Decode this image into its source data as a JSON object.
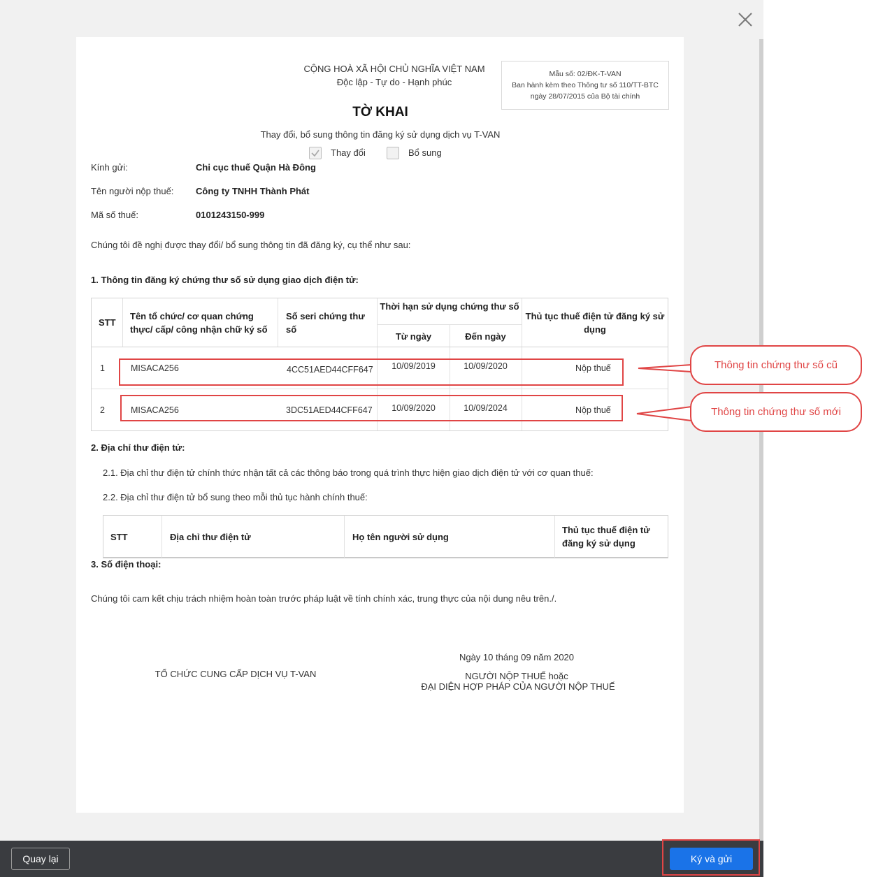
{
  "header": {
    "country": "CỘNG HOÀ XÃ HỘI CHỦ NGHĨA VIỆT NAM",
    "motto": "Độc lập - Tự do - Hạnh phúc",
    "form_no": "Mẫu số: 02/ĐK-T-VAN",
    "form_issued": "Ban hành kèm theo Thông tư số 110/TT-BTC",
    "form_date": "ngày 28/07/2015 của Bộ tài chính"
  },
  "doc": {
    "title": "TỜ KHAI",
    "subtitle": "Thay đổi, bổ sung thông tin đăng ký sử dụng dịch vụ T-VAN",
    "option_change": "Thay đổi",
    "option_add": "Bổ sung",
    "option_change_checked": true,
    "option_add_checked": false
  },
  "fields": [
    {
      "label": "Kính gửi:",
      "value": "Chi cục thuế Quận Hà Đông"
    },
    {
      "label": "Tên người nộp thuế:",
      "value": "Công ty TNHH Thành Phát"
    },
    {
      "label": "Mã số thuế:",
      "value": "0101243150-999"
    }
  ],
  "intro": "Chúng tôi đề nghị được thay đổi/ bổ sung thông tin đã đăng ký, cụ thể như sau:",
  "section1": {
    "title": "1. Thông tin đăng ký chứng thư số sử dụng giao dịch điện tử:",
    "headers": {
      "stt": "STT",
      "org": "Tên tổ chức/ cơ quan chứng thực/ cấp/ công nhận chữ ký số",
      "serial": "Số seri chứng thư số",
      "period": "Thời hạn sử dụng chứng thư số",
      "from": "Từ ngày",
      "to": "Đến ngày",
      "procedure": "Thủ tục thuế điện tử đăng ký sử dụng"
    },
    "rows": [
      {
        "stt": "1",
        "org": "MISACA256",
        "serial": "4CC51AED44CFF647",
        "from": "10/09/2019",
        "to": "10/09/2020",
        "procedure": "Nộp thuế"
      },
      {
        "stt": "2",
        "org": "MISACA256",
        "serial": "3DC51AED44CFF647",
        "from": "10/09/2020",
        "to": "10/09/2024",
        "procedure": "Nộp thuế"
      }
    ]
  },
  "section2": {
    "title": "2. Địa chỉ thư điện tử:",
    "item1": "2.1. Địa chỉ thư điện tử chính thức nhận tất cả các thông báo trong quá trình thực hiện giao dịch điện tử với cơ quan thuế:",
    "item2": "2.2. Địa chỉ thư điện tử bổ sung theo mỗi thủ tục hành chính thuế:",
    "headers": {
      "stt": "STT",
      "email": "Địa chỉ thư điện tử",
      "user": "Họ tên người sử dụng",
      "procedure": "Thủ tục thuế điện tử đăng ký sử dụng"
    }
  },
  "section3": {
    "title": "3. Số điện thoại:"
  },
  "commitment": "Chúng tôi cam kết chịu trách nhiệm hoàn toàn trước pháp luật về tính chính xác, trung thực của nội dung nêu trên./.",
  "signature": {
    "left": "TỔ CHỨC CUNG CẤP DỊCH VỤ T-VAN",
    "date": "Ngày 10 tháng 09 năm 2020",
    "right_line1": "NGƯỜI NỘP THUẾ hoặc",
    "right_line2": "ĐẠI DIỆN HỢP PHÁP CỦA NGƯỜI NỘP THUẾ"
  },
  "callouts": {
    "old": "Thông tin chứng thư số cũ",
    "new": "Thông tin chứng thư số mới"
  },
  "footer": {
    "back_label": "Quay lại",
    "sign_label": "Ký và gửi"
  },
  "icons": {
    "close": "close-icon",
    "check": "check-icon"
  },
  "colors": {
    "primary": "#1a73e8",
    "annotation": "#e04545",
    "footer_bg": "#3a3c40"
  }
}
